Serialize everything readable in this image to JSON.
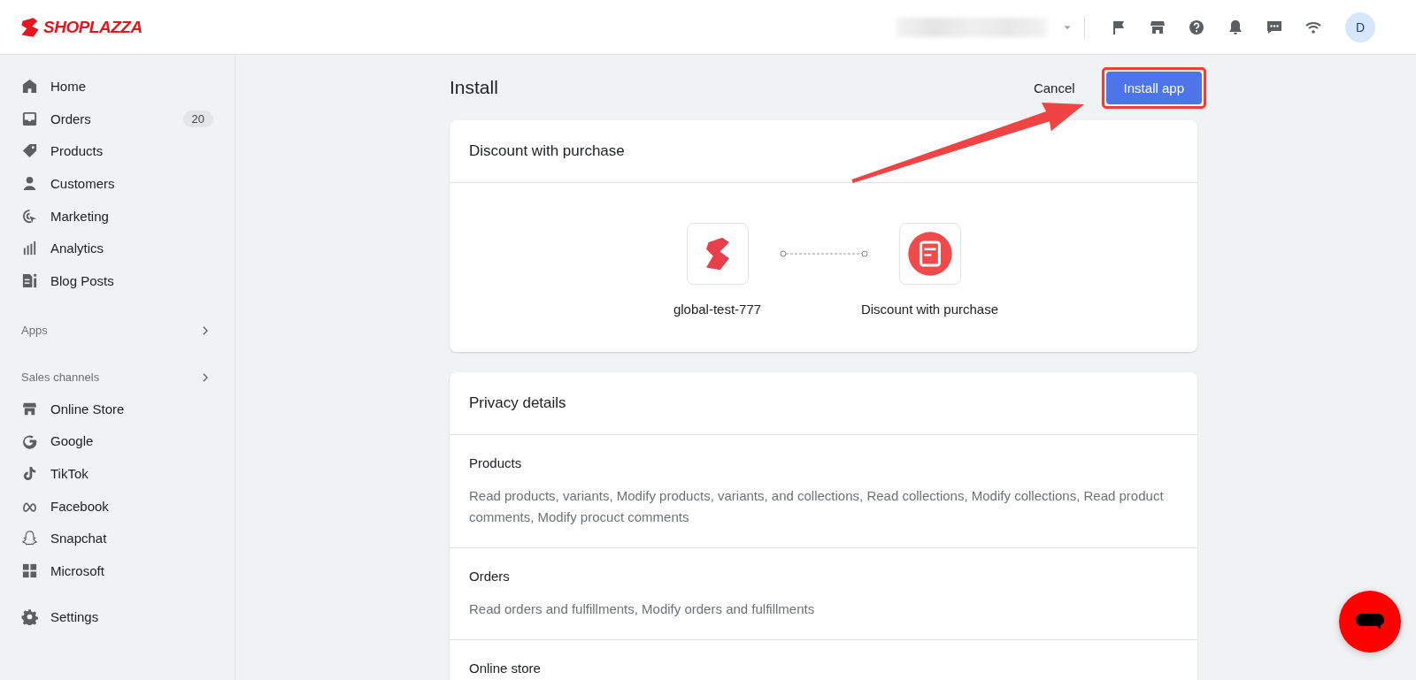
{
  "header": {
    "logo": "SHOPLAZZA",
    "avatar": "D"
  },
  "sidebar": {
    "main_items": [
      {
        "label": "Home"
      },
      {
        "label": "Orders",
        "badge": "20"
      },
      {
        "label": "Products"
      },
      {
        "label": "Customers"
      },
      {
        "label": "Marketing"
      },
      {
        "label": "Analytics"
      },
      {
        "label": "Blog Posts"
      }
    ],
    "apps": {
      "label": "Apps"
    },
    "sales_channels": {
      "label": "Sales channels",
      "items": [
        {
          "label": "Online Store"
        },
        {
          "label": "Google"
        },
        {
          "label": "TikTok"
        },
        {
          "label": "Facebook"
        },
        {
          "label": "Snapchat"
        },
        {
          "label": "Microsoft"
        }
      ]
    },
    "settings": {
      "label": "Settings"
    }
  },
  "page": {
    "title": "Install",
    "cancel": "Cancel",
    "primary": "Install app",
    "app_card": {
      "title": "Discount with purchase",
      "store": "global-test-777",
      "app": "Discount with purchase"
    },
    "privacy": {
      "title": "Privacy details",
      "sections": [
        {
          "title": "Products",
          "text": "Read products, variants, Modify products, variants, and collections, Read collections, Modify collections, Read product comments, Modify procuct comments"
        },
        {
          "title": "Orders",
          "text": "Read orders and fulfillments, Modify orders and fulfillments"
        },
        {
          "title": "Online store"
        }
      ]
    }
  }
}
